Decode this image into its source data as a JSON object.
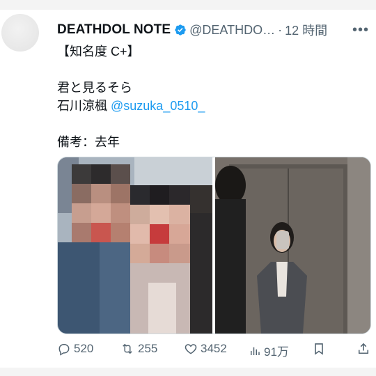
{
  "author": {
    "name": "DEATHDOL NOTE",
    "handle": "@DEATHDO…",
    "separator": "·",
    "time": "12 時間",
    "more_label": "•••"
  },
  "tweet": {
    "line1": "【知名度 C+】",
    "line2": "君と見るそら",
    "line3_name": "石川涼楓 ",
    "line3_mention": "@suzuka_0510_",
    "line4": "備考：去年"
  },
  "media": {
    "photos": [
      "photo-left",
      "photo-right"
    ]
  },
  "actions": {
    "reply_count": "520",
    "retweet_count": "255",
    "like_count": "3452",
    "views_count": "91万"
  },
  "colors": {
    "accent": "#1d9bf0",
    "secondary_text": "#536471",
    "primary_text": "#0f1419"
  }
}
